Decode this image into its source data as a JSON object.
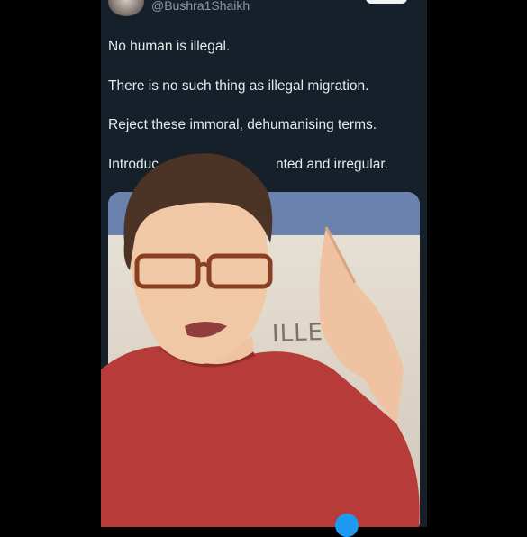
{
  "tweet": {
    "handle": "@Bushra1Shaikh",
    "lines": [
      "No human is illegal.",
      "There is no such thing as illegal migration.",
      "Reject these immoral, dehumanising terms."
    ],
    "line4_start": "Introduc",
    "line4_end": "nted and irregular."
  },
  "media": {
    "visible_text": "ILLE"
  },
  "colors": {
    "background": "#000000",
    "panel": "#15202b",
    "text": "#e7e9ea",
    "handle": "#8b98a5",
    "shirt": "#b63b39",
    "glasses": "#8a3f22"
  }
}
